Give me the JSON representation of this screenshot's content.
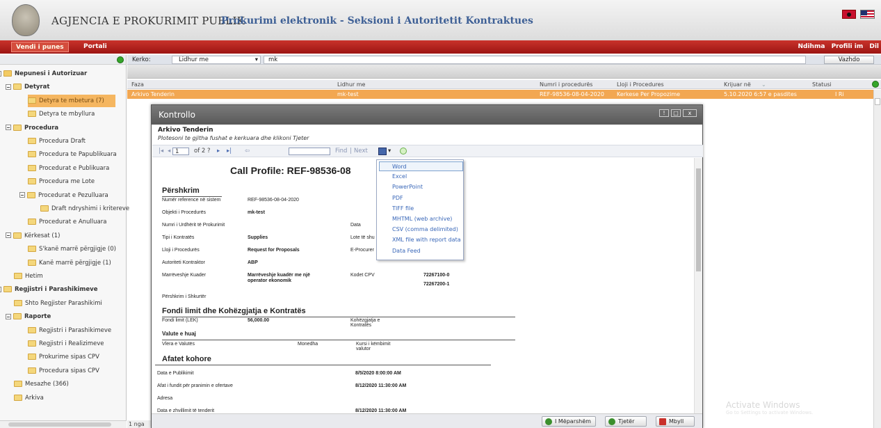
{
  "header": {
    "agency": "AGJENCIA E PROKURIMIT PUBLIK",
    "subtitle": "Prokurimi elektronik - Seksioni i Autoritetit Kontraktues"
  },
  "topnav": {
    "vendi": "Vendi i punes",
    "portali": "Portali",
    "ndihma": "Ndihma",
    "profili": "Profili im",
    "dil": "Dil"
  },
  "tree": [
    {
      "label": "Nepunesi i Autorizuar",
      "bold": true
    },
    {
      "label": "Detyrat",
      "bold": true
    },
    {
      "label": "Detyra te mbetura (7)",
      "selected": true
    },
    {
      "label": "Detyra te mbyllura"
    },
    {
      "label": "Procedura",
      "bold": true
    },
    {
      "label": "Procedura Draft"
    },
    {
      "label": "Procedura te Papublikuara"
    },
    {
      "label": "Procedurat e Publikuara"
    },
    {
      "label": "Procedura me Lote"
    },
    {
      "label": "Procedurat e Pezulluara"
    },
    {
      "label": "Draft ndryshimi i kritereve"
    },
    {
      "label": "Procedurat e Anulluara"
    },
    {
      "label": "Kërkesat (1)"
    },
    {
      "label": "S'kanë marrë përgjigje (0)"
    },
    {
      "label": "Kanë marrë përgjigje (1)"
    },
    {
      "label": "Hetim"
    },
    {
      "label": "Regjistri i Parashikimeve",
      "bold": true
    },
    {
      "label": "Shto Regjister Parashikimi"
    },
    {
      "label": "Raporte",
      "bold": true
    },
    {
      "label": "Regjistri i Parashikimeve"
    },
    {
      "label": "Regjistri i Realizimeve"
    },
    {
      "label": "Prokurime sipas CPV"
    },
    {
      "label": "Procedura sipas CPV"
    },
    {
      "label": "Mesazhe (366)"
    },
    {
      "label": "Arkiva"
    }
  ],
  "search": {
    "label": "Kerko:",
    "field": "Lidhur me",
    "query": "mk",
    "button": "Vazhdo"
  },
  "table": {
    "columns": [
      "Faza",
      "Lidhur me",
      "Numri i procedurës",
      "Lloji i Procedures",
      "Krijuar në",
      "Statusi"
    ],
    "row": [
      "Arkivo Tenderin",
      "mk-test",
      "REF-98536-08-04-2020",
      "Kerkese Per Propozime",
      "5.10.2020 6:57 e pasdites",
      "I Ri"
    ]
  },
  "dialog": {
    "title": "Kontrollo",
    "heading": "Arkivo Tenderin",
    "instruction": "Plotesoni te gjitha fushat e kerkuara dhe klikoni Tjeter",
    "page": "1",
    "of": "of 2 ?",
    "find": "Find",
    "next": "Next",
    "btn_prev": "I Mëparshëm",
    "btn_next": "Tjetër",
    "btn_close": "Mbyll"
  },
  "export_menu": [
    "Word",
    "Excel",
    "PowerPoint",
    "PDF",
    "TIFF file",
    "MHTML (web archive)",
    "CSV (comma delimited)",
    "XML file with report data",
    "Data Feed"
  ],
  "report": {
    "title": "Call Profile: REF-98536-08",
    "s1": "Përshkrim",
    "ref_label": "Numër reference në sistem",
    "ref_val": "REF-98536-08-04-2020",
    "obj_label": "Objekti i Procedurës",
    "obj_val": "mk-test",
    "num_label": "Numri i Urdhërit të Prokurimit",
    "data_label": "Data",
    "tipi_label": "Tipi i Kontratës",
    "tipi_val": "Supplies",
    "lote_label": "Lote të shu",
    "lloji_label": "Lloji i Procedurës",
    "lloji_val": "Request for Proposals",
    "eproc_label": "E-Procurer",
    "aut_label": "Autoriteti Kontraktor",
    "aut_val": "ABP",
    "marr_label": "Marrëveshje Kuader",
    "marr_val": "Marrëveshje kuadër me një operator ekonomik",
    "cpv_label": "Kodet CPV",
    "cpv1": "72267100-0",
    "cpv2": "72267200-1",
    "short_label": "Përshkrim i Shkurtër",
    "s2": "Fondi limit dhe Kohëzgjatja e Kontratës",
    "fondi_label": "Fondi limit (LEK)",
    "fondi_val": "56,000.00",
    "koh_label": "Kohëzgjatja e Kontratës",
    "s3": "Valute e huaj",
    "vlera_label": "Vlera e Valutës",
    "monedha_label": "Monedha",
    "kursi_label": "Kursi i këmbimit valutor",
    "s4": "Afatet kohore",
    "pub_label": "Data e Publikimit",
    "pub_val": "8/5/2020 8:00:00 AM",
    "afat_label": "Afat i fundit për pranimin e ofertave",
    "afat_val": "8/12/2020 11:30:00 AM",
    "adresa_label": "Adresa",
    "zhv_label": "Data e zhvillimit të tenderit",
    "zhv_val": "8/12/2020 11:30:00 AM"
  },
  "footer": {
    "page": "1 nga"
  },
  "watermark": {
    "line1": "Activate Windows",
    "line2": "Go to Settings to activate Windows."
  }
}
